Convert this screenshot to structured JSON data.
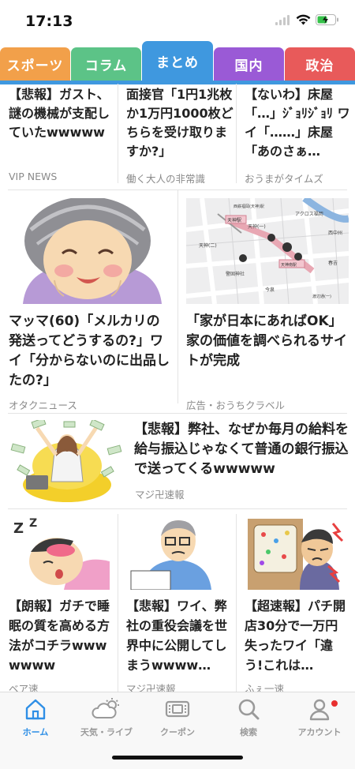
{
  "status_bar": {
    "time": "17:13"
  },
  "tabs": [
    {
      "label": "スポーツ",
      "color": "#f2a04a"
    },
    {
      "label": "コラム",
      "color": "#5cc387"
    },
    {
      "label": "まとめ",
      "color": "#3f98df",
      "active": true
    },
    {
      "label": "国内",
      "color": "#9a5ad6"
    },
    {
      "label": "政治",
      "color": "#e85a5a"
    }
  ],
  "articles": {
    "top_1": {
      "title": "【悲報】ガスト、謎の機械が支配していたwwwww",
      "source": "VIP NEWS"
    },
    "top_2": {
      "title": "面接官「1円1兆枚か1万円1000枚どちらを受け取りますか?」",
      "source": "働く大人の非常識"
    },
    "top_3": {
      "title": "【ないわ】床屋「…」ｼﾞｮﾘｼﾞｮﾘ ワイ「……」床屋「あのさぁ…",
      "source": "おうまがタイムズ"
    },
    "mid_1": {
      "title": "マッマ(60)「メルカリの発送ってどうするの?」ワイ「分からないのに出品したの?」",
      "source": "オタクニュース"
    },
    "mid_2": {
      "title": "「家が日本にあればOK」家の価値を調べられるサイトが完成",
      "source": "広告・おうちクラベル"
    },
    "wide": {
      "title": "【悲報】弊社、なぜか毎月の給料を給与振込じゃなくて普通の銀行振込で送ってくるwwwww",
      "source": "マジ卍速報"
    },
    "bot_1": {
      "title": "【朗報】ガチで睡眠の質を高める方法がコチラwwwwwww",
      "source": "ベア速"
    },
    "bot_2": {
      "title": "【悲報】ワイ、弊社の重役会議を世界中に公開してしまうwwww…",
      "source": "マジ卍速報"
    },
    "bot_3": {
      "title": "【超速報】パチ開店30分で一万円失ったワイ「違う!これは…",
      "source": "ふぇ一速"
    }
  },
  "map": {
    "labels": [
      "天神駅",
      "天神(一)",
      "天神(二)",
      "アクロス福岡",
      "西中州",
      "天神南駅",
      "警固神社",
      "春吉",
      "渡辺通(一)",
      "今泉",
      "西鉄福岡(天神)駅"
    ]
  },
  "bottom_nav": [
    {
      "label": "ホーム",
      "icon": "home-icon",
      "active": true
    },
    {
      "label": "天気・ライブ",
      "icon": "weather-icon"
    },
    {
      "label": "クーポン",
      "icon": "coupon-icon"
    },
    {
      "label": "検索",
      "icon": "search-icon"
    },
    {
      "label": "アカウント",
      "icon": "account-icon",
      "badge": true
    }
  ],
  "colors": {
    "accent": "#2f8fe6",
    "badge": "#e83030"
  }
}
